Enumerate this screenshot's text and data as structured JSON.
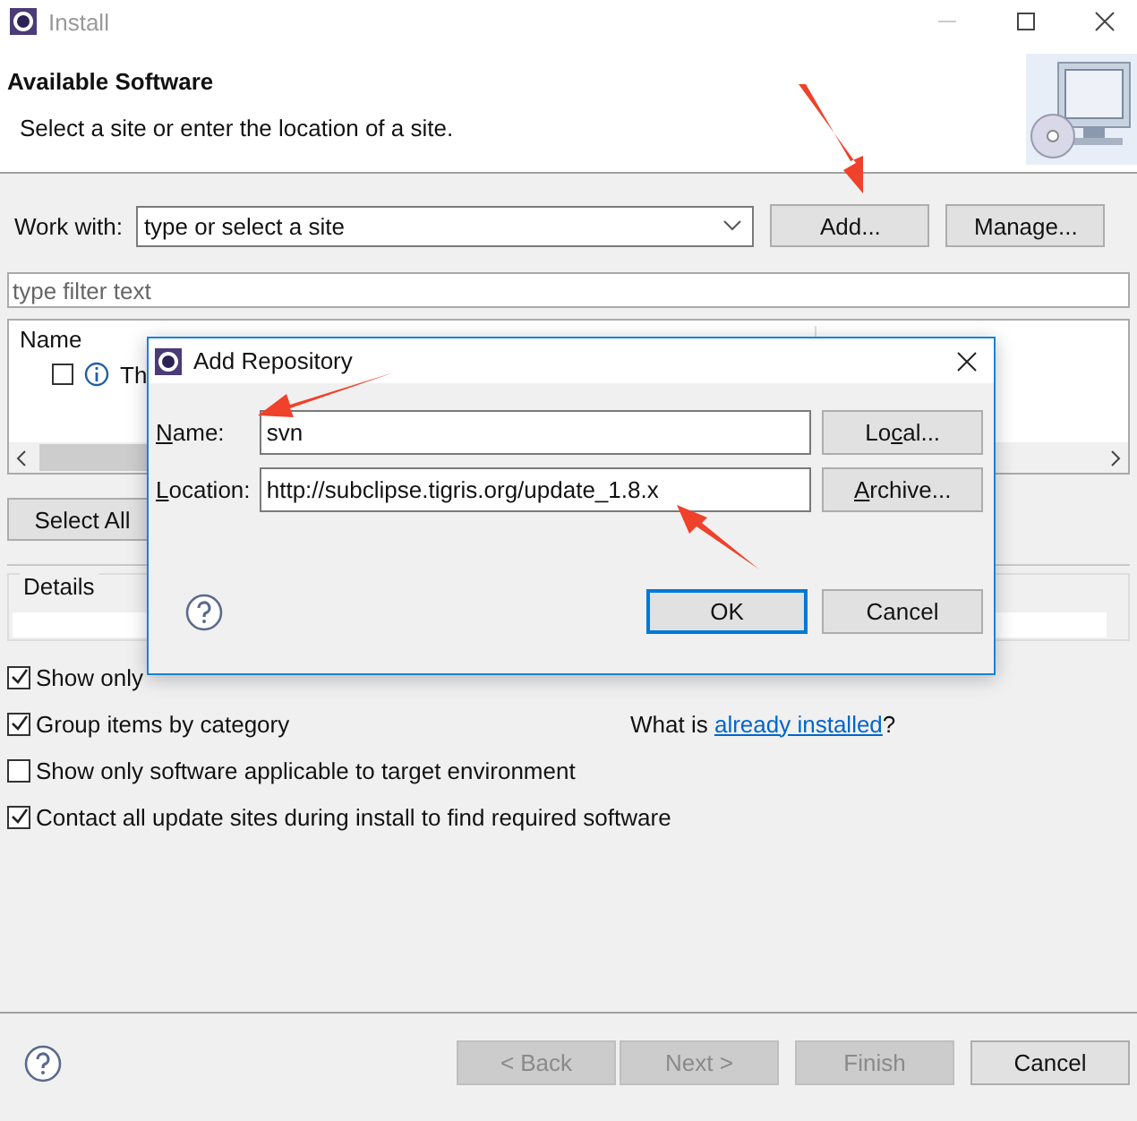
{
  "window": {
    "title": "Install"
  },
  "header": {
    "title": "Available Software",
    "subtitle": "Select a site or enter the location of a site."
  },
  "work_with": {
    "label": "Work with:",
    "value": "type or select a site",
    "buttons": [
      "Add...",
      "Manage..."
    ]
  },
  "filter": {
    "placeholder": "type filter text"
  },
  "tree": {
    "columns": [
      "Name"
    ],
    "rows": [
      {
        "label": "Th",
        "checked": false
      }
    ]
  },
  "select_all": "Select All",
  "details": {
    "label": "Details"
  },
  "options": [
    {
      "label": "Show only",
      "checked": true
    },
    {
      "label": "Group items by category",
      "checked": true
    },
    {
      "label": "Show only software applicable to target environment",
      "checked": false
    },
    {
      "label": "Contact all update sites during install to find required software",
      "checked": true
    }
  ],
  "installed_link": {
    "prefix": "What is ",
    "link": "already installed",
    "suffix": "?"
  },
  "footer_buttons": [
    {
      "label": "< Back",
      "disabled": true
    },
    {
      "label": "Next >",
      "disabled": true
    },
    {
      "label": "Finish",
      "disabled": true
    },
    {
      "label": "Cancel",
      "disabled": false
    }
  ],
  "dialog": {
    "title": "Add Repository",
    "fields": [
      {
        "key": "N",
        "rest": "ame:",
        "value": "svn",
        "button_pre": "Lo",
        "button_key2": "c",
        "button_rest": "al..."
      },
      {
        "key": "L",
        "rest": "ocation:",
        "value": "http://subclipse.tigris.org/update_1.8.x",
        "button_key2": "A",
        "button_rest": "rchive..."
      }
    ],
    "buttons": [
      {
        "label": "OK",
        "default": true
      },
      {
        "label": "Cancel",
        "default": false
      }
    ]
  }
}
